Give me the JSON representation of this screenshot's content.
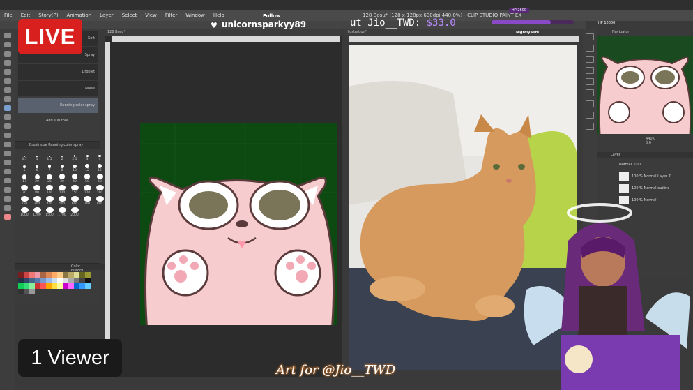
{
  "menu": {
    "items": [
      "File",
      "Edit",
      "Story(P)",
      "Animation",
      "Layer",
      "Select",
      "View",
      "Filter",
      "Window",
      "Help"
    ],
    "window_title": "128 Bosu* (128 x 128px 600dpi 440.0%) - CLIP STUDIO PAINT EX"
  },
  "canvas_tabs": {
    "left": "128 Bosu*",
    "right": "Illustration*"
  },
  "brushes": {
    "items": [
      {
        "label": "Soft"
      },
      {
        "label": "Spray"
      },
      {
        "label": "Droplet"
      },
      {
        "label": "Noise"
      },
      {
        "label": "Running color spray"
      }
    ],
    "add_sub_tool": "Add sub tool"
  },
  "brush_size": {
    "header": "Brush size Running color spray",
    "sizes": [
      "0.7",
      "1",
      "1.5",
      "2",
      "2.5",
      "3",
      "4",
      "5",
      "6",
      "7",
      "8",
      "10",
      "12",
      "15",
      "17",
      "20",
      "25",
      "30",
      "40",
      "50",
      "60",
      "70",
      "80",
      "100",
      "120",
      "150",
      "170",
      "200",
      "250",
      "300",
      "400",
      "500",
      "600",
      "700",
      "800",
      "1000",
      "1200",
      "1500",
      "1700",
      "2000"
    ]
  },
  "color_panel": {
    "header": "Color history",
    "colors": [
      "#7a1f1f",
      "#c44",
      "#e77",
      "#e9a",
      "#a64",
      "#d85",
      "#fa6",
      "#fc8",
      "#874",
      "#ba6",
      "#dd9",
      "#662",
      "#993",
      "#234",
      "#346",
      "#468",
      "#57a",
      "#79c",
      "#9be",
      "#cde",
      "#fff",
      "#ddd",
      "#aaa",
      "#777",
      "#444",
      "#111",
      "#1c5",
      "#3d7",
      "#8e9",
      "#c33",
      "#f55",
      "#fa0",
      "#fd4",
      "#ff9",
      "#c0c",
      "#f6f",
      "#06c",
      "#39f",
      "#6cf",
      "#333",
      "#555",
      "#999"
    ]
  },
  "navigator": {
    "header": "Navigator",
    "zoom": "440.0",
    "angle": "0.0"
  },
  "layers": {
    "header": "Layer",
    "blend": "Normal",
    "opacity": "100",
    "rows": [
      {
        "label": "100 % Normal",
        "sub": "Layer 7"
      },
      {
        "label": "100 % Normal",
        "sub": "outline"
      },
      {
        "label": "100 % Normal",
        "sub": ""
      }
    ]
  },
  "stream": {
    "live_label": "LIVE",
    "viewers": "1 Viewer",
    "follow_label": "Follow",
    "follower_name": "unicornsparkyy89",
    "sub_prefix": "ut ",
    "sub_name": "Jio__TWD:",
    "sub_amount": "$33.0",
    "hp_top": "HP 2600",
    "hp_side": "HP 10000",
    "hp_fraction": 0.72,
    "nightly_name": "NightlyAlibi",
    "art_for": "Art for @Jio__TWD"
  }
}
